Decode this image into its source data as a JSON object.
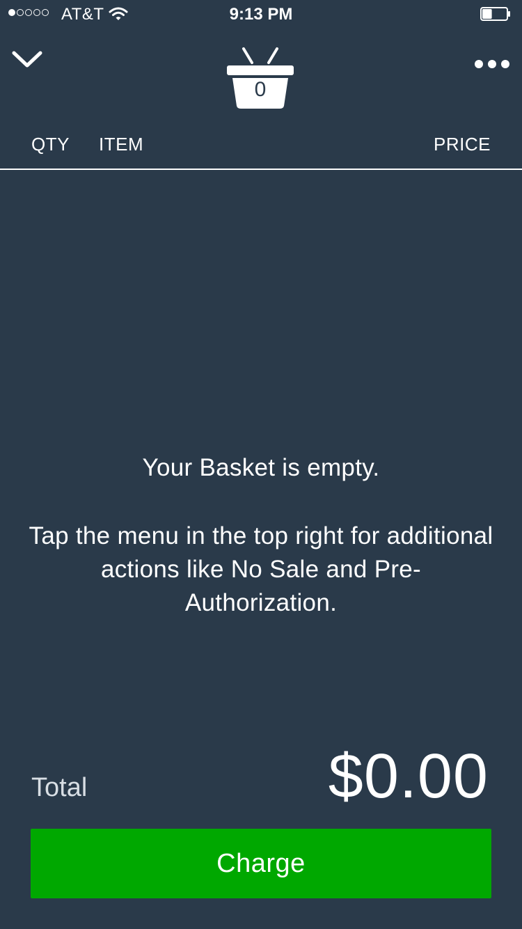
{
  "status_bar": {
    "signal_filled": 1,
    "signal_total": 5,
    "carrier": "AT&T",
    "time": "9:13 PM",
    "battery_level": 0.4,
    "wifi_icon": "wifi-icon",
    "battery_icon": "battery-icon"
  },
  "header": {
    "collapse_icon": "chevron-down-icon",
    "basket_icon": "basket-icon",
    "basket_count": "0",
    "more_icon": "more-dots-icon"
  },
  "columns": {
    "qty": "QTY",
    "item": "ITEM",
    "price": "PRICE"
  },
  "empty_state": {
    "title": "Your Basket is empty.",
    "body": "Tap the menu in the top right for additional actions like No Sale and Pre-Authorization."
  },
  "footer": {
    "total_label": "Total",
    "total_amount": "$0.00",
    "charge_label": "Charge"
  },
  "colors": {
    "background": "#2a3a4a",
    "charge_button": "#00a800",
    "text": "#ffffff"
  }
}
